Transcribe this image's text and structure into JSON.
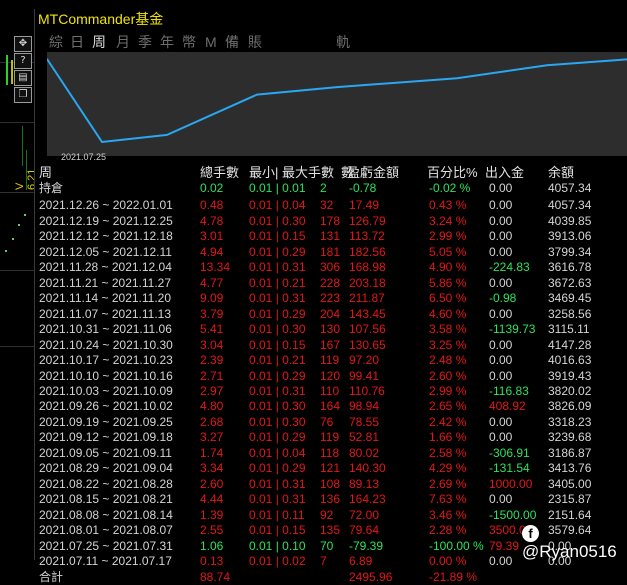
{
  "window": {
    "title": "MTCommander基金"
  },
  "left_toolbar": {
    "version_label": "V 6.21"
  },
  "tabs": [
    {
      "label": "綜",
      "active": false
    },
    {
      "label": "日",
      "active": false
    },
    {
      "label": "周",
      "active": true
    },
    {
      "label": "月",
      "active": false
    },
    {
      "label": "季",
      "active": false
    },
    {
      "label": "年",
      "active": false
    },
    {
      "label": "幣",
      "active": false
    },
    {
      "label": "M",
      "active": false
    },
    {
      "label": "備",
      "active": false
    },
    {
      "label": "賬戶",
      "active": false
    },
    {
      "label": "軌跡",
      "active": false
    }
  ],
  "chart": {
    "date_label": "2021.07.25"
  },
  "chart_data": {
    "type": "line",
    "series": [
      {
        "values": [
          4057.34,
          2151.64,
          2315.87,
          3239.68,
          3413.76,
          3616.78,
          3913.06,
          4057.34
        ]
      }
    ]
  },
  "table": {
    "headers": [
      "周",
      "總手數",
      "最小|",
      "最大手數",
      "數",
      "盈虧金額",
      "百分比%",
      "出入金",
      "余額"
    ],
    "rows": [
      {
        "period": "持倉",
        "lots": "0.02",
        "minmax": "0.01 | 0.01",
        "count": "2",
        "pnl": "-0.78",
        "pct": "-0.02 %",
        "flow": "0.00",
        "balance": "4057.34",
        "c": "g",
        "fc": "w"
      },
      {
        "period": "2021.12.26 ~ 2022.01.01",
        "lots": "0.48",
        "minmax": "0.01 | 0.04",
        "count": "32",
        "pnl": "17.49",
        "pct": "0.43 %",
        "flow": "0.00",
        "balance": "4057.34",
        "c": "r",
        "fc": "w"
      },
      {
        "period": "2021.12.19 ~ 2021.12.25",
        "lots": "4.78",
        "minmax": "0.01 | 0.30",
        "count": "178",
        "pnl": "126.79",
        "pct": "3.24 %",
        "flow": "0.00",
        "balance": "4039.85",
        "c": "r",
        "fc": "w"
      },
      {
        "period": "2021.12.12 ~ 2021.12.18",
        "lots": "3.01",
        "minmax": "0.01 | 0.15",
        "count": "131",
        "pnl": "113.72",
        "pct": "2.99 %",
        "flow": "0.00",
        "balance": "3913.06",
        "c": "r",
        "fc": "w"
      },
      {
        "period": "2021.12.05 ~ 2021.12.11",
        "lots": "4.94",
        "minmax": "0.01 | 0.29",
        "count": "181",
        "pnl": "182.56",
        "pct": "5.05 %",
        "flow": "0.00",
        "balance": "3799.34",
        "c": "r",
        "fc": "w"
      },
      {
        "period": "2021.11.28 ~ 2021.12.04",
        "lots": "13.34",
        "minmax": "0.01 | 0.31",
        "count": "306",
        "pnl": "168.98",
        "pct": "4.90 %",
        "flow": "-224.83",
        "balance": "3616.78",
        "c": "r",
        "fc": "g"
      },
      {
        "period": "2021.11.21 ~ 2021.11.27",
        "lots": "4.77",
        "minmax": "0.01 | 0.21",
        "count": "228",
        "pnl": "203.18",
        "pct": "5.86 %",
        "flow": "0.00",
        "balance": "3672.63",
        "c": "r",
        "fc": "w"
      },
      {
        "period": "2021.11.14 ~ 2021.11.20",
        "lots": "9.09",
        "minmax": "0.01 | 0.31",
        "count": "223",
        "pnl": "211.87",
        "pct": "6.50 %",
        "flow": "-0.98",
        "balance": "3469.45",
        "c": "r",
        "fc": "g"
      },
      {
        "period": "2021.11.07 ~ 2021.11.13",
        "lots": "3.79",
        "minmax": "0.01 | 0.29",
        "count": "204",
        "pnl": "143.45",
        "pct": "4.60 %",
        "flow": "0.00",
        "balance": "3258.56",
        "c": "r",
        "fc": "w"
      },
      {
        "period": "2021.10.31 ~ 2021.11.06",
        "lots": "5.41",
        "minmax": "0.01 | 0.30",
        "count": "130",
        "pnl": "107.56",
        "pct": "3.58 %",
        "flow": "-1139.73",
        "balance": "3115.11",
        "c": "r",
        "fc": "g"
      },
      {
        "period": "2021.10.24 ~ 2021.10.30",
        "lots": "3.04",
        "minmax": "0.01 | 0.15",
        "count": "167",
        "pnl": "130.65",
        "pct": "3.25 %",
        "flow": "0.00",
        "balance": "4147.28",
        "c": "r",
        "fc": "w"
      },
      {
        "period": "2021.10.17 ~ 2021.10.23",
        "lots": "2.39",
        "minmax": "0.01 | 0.21",
        "count": "119",
        "pnl": "97.20",
        "pct": "2.48 %",
        "flow": "0.00",
        "balance": "4016.63",
        "c": "r",
        "fc": "w"
      },
      {
        "period": "2021.10.10 ~ 2021.10.16",
        "lots": "2.71",
        "minmax": "0.01 | 0.29",
        "count": "120",
        "pnl": "99.41",
        "pct": "2.60 %",
        "flow": "0.00",
        "balance": "3919.43",
        "c": "r",
        "fc": "w"
      },
      {
        "period": "2021.10.03 ~ 2021.10.09",
        "lots": "2.97",
        "minmax": "0.01 | 0.31",
        "count": "110",
        "pnl": "110.76",
        "pct": "2.99 %",
        "flow": "-116.83",
        "balance": "3820.02",
        "c": "r",
        "fc": "g"
      },
      {
        "period": "2021.09.26 ~ 2021.10.02",
        "lots": "4.80",
        "minmax": "0.01 | 0.30",
        "count": "164",
        "pnl": "98.94",
        "pct": "2.65 %",
        "flow": "408.92",
        "balance": "3826.09",
        "c": "r",
        "fc": "r"
      },
      {
        "period": "2021.09.19 ~ 2021.09.25",
        "lots": "2.68",
        "minmax": "0.01 | 0.30",
        "count": "76",
        "pnl": "78.55",
        "pct": "2.42 %",
        "flow": "0.00",
        "balance": "3318.23",
        "c": "r",
        "fc": "w"
      },
      {
        "period": "2021.09.12 ~ 2021.09.18",
        "lots": "3.27",
        "minmax": "0.01 | 0.29",
        "count": "119",
        "pnl": "52.81",
        "pct": "1.66 %",
        "flow": "0.00",
        "balance": "3239.68",
        "c": "r",
        "fc": "w"
      },
      {
        "period": "2021.09.05 ~ 2021.09.11",
        "lots": "1.74",
        "minmax": "0.01 | 0.04",
        "count": "118",
        "pnl": "80.02",
        "pct": "2.58 %",
        "flow": "-306.91",
        "balance": "3186.87",
        "c": "r",
        "fc": "g"
      },
      {
        "period": "2021.08.29 ~ 2021.09.04",
        "lots": "3.34",
        "minmax": "0.01 | 0.29",
        "count": "121",
        "pnl": "140.30",
        "pct": "4.29 %",
        "flow": "-131.54",
        "balance": "3413.76",
        "c": "r",
        "fc": "g"
      },
      {
        "period": "2021.08.22 ~ 2021.08.28",
        "lots": "2.60",
        "minmax": "0.01 | 0.31",
        "count": "108",
        "pnl": "89.13",
        "pct": "2.69 %",
        "flow": "1000.00",
        "balance": "3405.00",
        "c": "r",
        "fc": "r"
      },
      {
        "period": "2021.08.15 ~ 2021.08.21",
        "lots": "4.44",
        "minmax": "0.01 | 0.31",
        "count": "136",
        "pnl": "164.23",
        "pct": "7.63 %",
        "flow": "0.00",
        "balance": "2315.87",
        "c": "r",
        "fc": "w"
      },
      {
        "period": "2021.08.08 ~ 2021.08.14",
        "lots": "1.39",
        "minmax": "0.01 | 0.11",
        "count": "92",
        "pnl": "72.00",
        "pct": "3.46 %",
        "flow": "-1500.00",
        "balance": "2151.64",
        "c": "r",
        "fc": "g"
      },
      {
        "period": "2021.08.01 ~ 2021.08.07",
        "lots": "2.55",
        "minmax": "0.01 | 0.15",
        "count": "135",
        "pnl": "79.64",
        "pct": "2.28 %",
        "flow": "3500.00",
        "balance": "3579.64",
        "c": "r",
        "fc": "r"
      },
      {
        "period": "2021.07.25 ~ 2021.07.31",
        "lots": "1.06",
        "minmax": "0.01 | 0.10",
        "count": "70",
        "pnl": "-79.39",
        "pct": "-100.00 %",
        "flow": "79.39",
        "balance": "0.00",
        "c": "g",
        "fc": "r"
      },
      {
        "period": "2021.07.11 ~ 2021.07.17",
        "lots": "0.13",
        "minmax": "0.01 | 0.02",
        "count": "7",
        "pnl": "6.89",
        "pct": "0.00 %",
        "flow": "0.00",
        "balance": "0.00",
        "c": "r",
        "fc": "w"
      },
      {
        "period": "合計",
        "lots": "88.74",
        "minmax": "",
        "count": "",
        "pnl": "2495.96",
        "pct": "-21.89 %",
        "flow": "",
        "balance": "",
        "c": "r",
        "fc": "w"
      }
    ]
  },
  "watermark": {
    "text": "@Ryan0516",
    "icon": "facebook-icon"
  }
}
